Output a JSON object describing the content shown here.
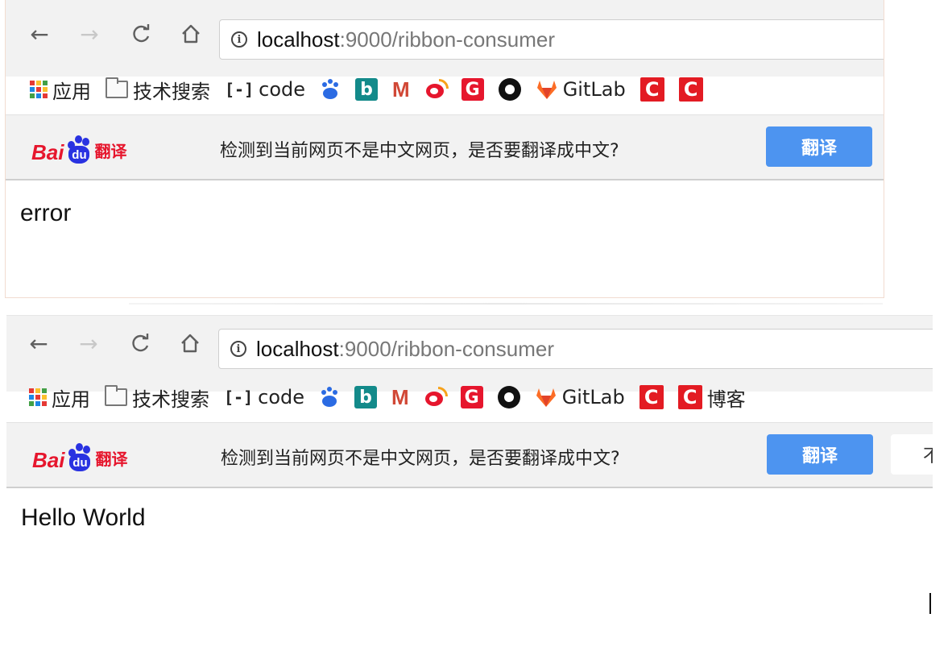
{
  "windows": [
    {
      "url": {
        "host": "localhost",
        "rest": ":9000/ribbon-consumer"
      },
      "bookmarks": {
        "apps": "应用",
        "folder": "技术搜索",
        "code": "code",
        "gitlab": "GitLab"
      },
      "translate_bar": {
        "logo_text": "Bai",
        "logo_du": "du",
        "logo_fanyi": "翻译",
        "message": "检测到当前网页不是中文网页，是否要翻译成中文?",
        "translate_button": "翻译"
      },
      "content": "error"
    },
    {
      "url": {
        "host": "localhost",
        "rest": ":9000/ribbon-consumer"
      },
      "bookmarks": {
        "apps": "应用",
        "folder": "技术搜索",
        "code": "code",
        "gitlab": "GitLab",
        "blog": "博客"
      },
      "translate_bar": {
        "logo_text": "Bai",
        "logo_du": "du",
        "logo_fanyi": "翻译",
        "message": "检测到当前网页不是中文网页，是否要翻译成中文?",
        "translate_button": "翻译",
        "cancel_button": "不"
      },
      "content": "Hello World"
    }
  ],
  "icons": {
    "back": "←",
    "forward": "→",
    "reload": "C",
    "home": "⌂",
    "info": "i",
    "bing": "b",
    "gmail": "M",
    "g": "G",
    "c": "C",
    "baidu_paw": "🐾"
  },
  "colors": {
    "translate_button": "#4d94f0",
    "baidu_red": "#e6162d",
    "baidu_blue": "#2932e1"
  }
}
